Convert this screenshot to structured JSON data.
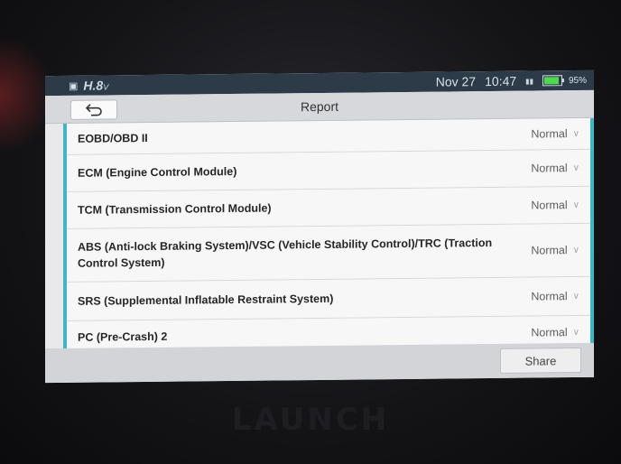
{
  "device": {
    "brand": "LAUNCH"
  },
  "status_bar": {
    "voltage": "H.8",
    "voltage_unit": "V",
    "date": "Nov 27",
    "time": "10:47",
    "battery": "95%"
  },
  "header": {
    "back_icon": "back-arrow-icon",
    "title": "Report"
  },
  "report": {
    "items": [
      {
        "name": "EOBD/OBD II",
        "status": "Normal"
      },
      {
        "name": "ECM (Engine Control Module)",
        "status": "Normal"
      },
      {
        "name": "TCM (Transmission Control Module)",
        "status": "Normal"
      },
      {
        "name": "ABS (Anti-lock Braking System)/VSC (Vehicle Stability Control)/TRC (Traction Control System)",
        "status": "Normal"
      },
      {
        "name": "SRS (Supplemental Inflatable Restraint System)",
        "status": "Normal"
      },
      {
        "name": "PC (Pre-Crash) 2",
        "status": "Normal"
      }
    ]
  },
  "footer": {
    "share_label": "Share"
  },
  "colors": {
    "accent": "#3cb7c6",
    "status_bar": "#2d3a47",
    "battery": "#4fd94f"
  }
}
